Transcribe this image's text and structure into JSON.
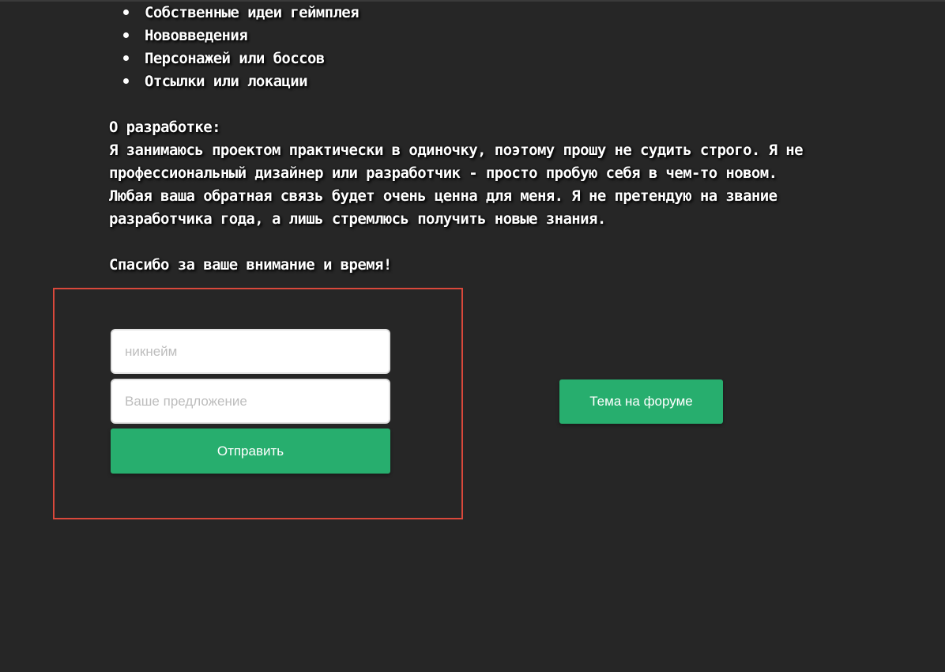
{
  "bullets": [
    "Собственные идеи геймплея",
    "Нововведения",
    "Персонажей или боссов",
    "Отсылки или локации"
  ],
  "about": {
    "heading": "О разработке:",
    "lines": [
      "Я занимаюсь проектом практически в одиночку, поэтому прошу не судить строго. Я не",
      "профессиональный дизайнер или разработчик - просто пробую себя в чем-то новом.",
      "Любая ваша обратная связь будет очень ценна для меня. Я не претендую на звание",
      "разработчика года, а лишь стремлюсь получить новые знания."
    ]
  },
  "thanks": "Спасибо за ваше внимание и время!",
  "form": {
    "nickname_placeholder": "никнейм",
    "nickname_value": "",
    "suggestion_placeholder": "Ваше предложение",
    "suggestion_value": "",
    "submit_label": "Отправить"
  },
  "forum_button_label": "Тема на форуме",
  "colors": {
    "background": "#262626",
    "accent": "#27ae6e",
    "highlight_border": "#d9483b"
  }
}
